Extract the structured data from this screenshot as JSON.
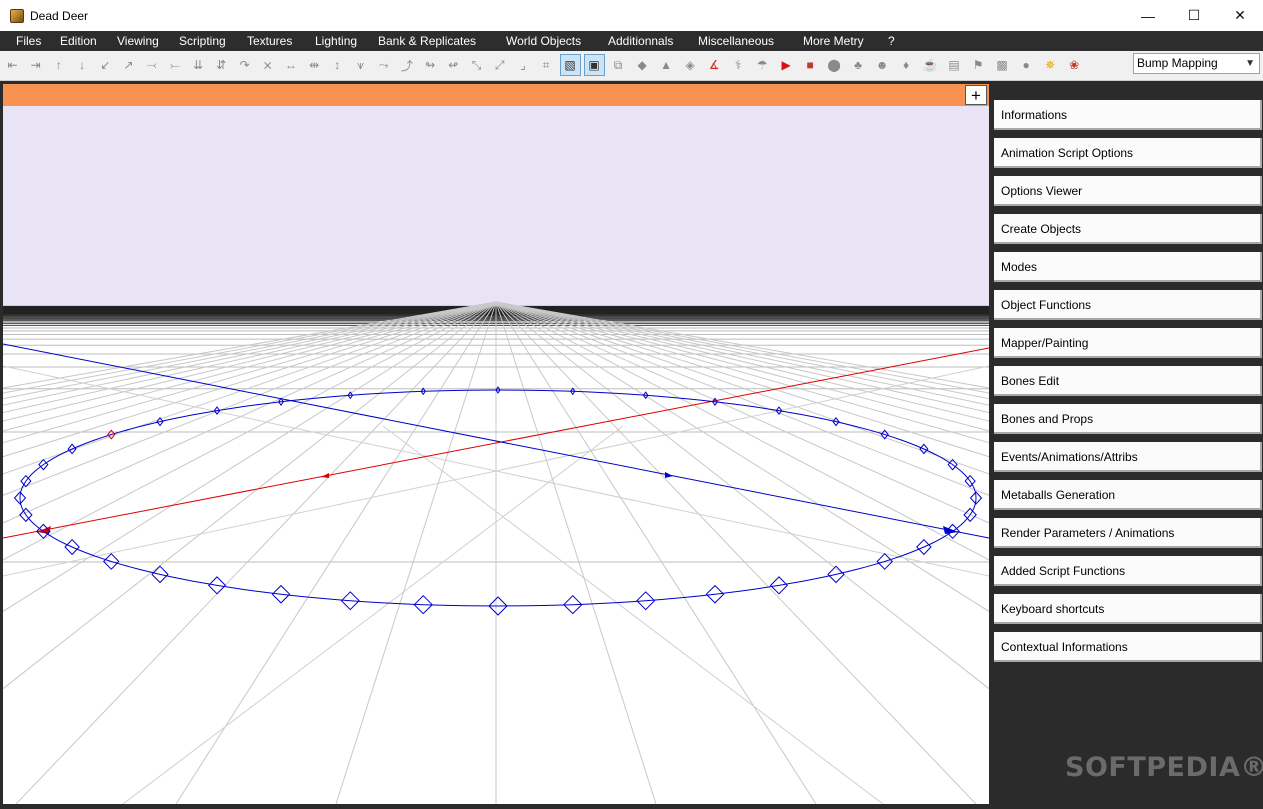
{
  "window": {
    "title": "Dead Deer",
    "minimize": "—",
    "maximize": "☐",
    "close": "✕"
  },
  "menu": [
    "Files",
    "Edition",
    "Viewing",
    "Scripting",
    "Textures",
    "Lighting",
    "Bank & Replicates",
    "World Objects",
    "Additionnals",
    "Miscellaneous",
    "More Metry",
    "?"
  ],
  "toolbar": {
    "tools": [
      {
        "name": "weld-left-tool",
        "glyph": "⇤"
      },
      {
        "name": "weld-right-tool",
        "glyph": "⇥"
      },
      {
        "name": "move-up-tool",
        "glyph": "↑"
      },
      {
        "name": "move-down-tool",
        "glyph": "↓"
      },
      {
        "name": "split-diag-tool",
        "glyph": "↙"
      },
      {
        "name": "merge-diag-tool",
        "glyph": "↗"
      },
      {
        "name": "fork-left-tool",
        "glyph": "⤙"
      },
      {
        "name": "fork-right-tool",
        "glyph": "⤚"
      },
      {
        "name": "branch-down-tool",
        "glyph": "⇊"
      },
      {
        "name": "branch-split-tool",
        "glyph": "⇵"
      },
      {
        "name": "twist-tool",
        "glyph": "↷"
      },
      {
        "name": "cross-tool",
        "glyph": "⨯"
      },
      {
        "name": "stretch-h-tool",
        "glyph": "↔"
      },
      {
        "name": "compress-tool",
        "glyph": "⇹"
      },
      {
        "name": "stretch-v-tool",
        "glyph": "↕"
      },
      {
        "name": "fan-tool",
        "glyph": "⩛"
      },
      {
        "name": "bend-right-tool",
        "glyph": "⤳"
      },
      {
        "name": "bend-left-tool",
        "glyph": "⤴"
      },
      {
        "name": "curve-tool",
        "glyph": "↬"
      },
      {
        "name": "curve-down-tool",
        "glyph": "↫"
      },
      {
        "name": "slope-tool",
        "glyph": "⤡"
      },
      {
        "name": "ramp-tool",
        "glyph": "⤢"
      },
      {
        "name": "corner-tool",
        "glyph": "⌟"
      },
      {
        "name": "grid-tool",
        "glyph": "⌗"
      },
      {
        "name": "cube-wire-tool",
        "glyph": "▧",
        "active": true
      },
      {
        "name": "cube-solid-tool",
        "glyph": "▣",
        "active": true
      },
      {
        "name": "cubes-tool",
        "glyph": "⧉"
      },
      {
        "name": "prism-tool",
        "glyph": "◆"
      },
      {
        "name": "pyramid-tool",
        "glyph": "▲"
      },
      {
        "name": "wedge-tool",
        "glyph": "◈"
      },
      {
        "name": "bone-red-tool",
        "glyph": "∡",
        "color": "#d22222"
      },
      {
        "name": "skeleton-tool",
        "glyph": "⚕"
      },
      {
        "name": "mushroom-tool",
        "glyph": "☂"
      },
      {
        "name": "play-tool",
        "glyph": "▶",
        "color": "#e01010"
      },
      {
        "name": "box-red-tool",
        "glyph": "■",
        "color": "#c0392b"
      },
      {
        "name": "blob-tool",
        "glyph": "⬤"
      },
      {
        "name": "tree-tool",
        "glyph": "♣"
      },
      {
        "name": "head-tool",
        "glyph": "☻"
      },
      {
        "name": "duck-tool",
        "glyph": "♦"
      },
      {
        "name": "pot-tool",
        "glyph": "☕"
      },
      {
        "name": "frame-tool",
        "glyph": "▤"
      },
      {
        "name": "bottle-tool",
        "glyph": "⚑"
      },
      {
        "name": "picture-tool",
        "glyph": "▩"
      },
      {
        "name": "sphere-tool",
        "glyph": "●"
      },
      {
        "name": "render-tool",
        "glyph": "✵",
        "color": "#e6a300"
      },
      {
        "name": "settings-tool",
        "glyph": "❀",
        "color": "#c0392b"
      }
    ],
    "render_mode": "Bump Mapping"
  },
  "panels": [
    "Informations",
    "Animation Script Options",
    "Options Viewer",
    "Create Objects",
    "Modes",
    "Object Functions",
    "Mapper/Painting",
    "Bones Edit",
    "Bones and Props",
    "Events/Animations/Attribs",
    "Metaballs Generation",
    "Render Parameters / Animations",
    "Added Script Functions",
    "Keyboard shortcuts",
    "Contextual Informations"
  ],
  "viewport": {
    "add_button": "+",
    "sky_color": "#e8e4f6",
    "header_color": "#f79250",
    "path_color": "#0000cc",
    "axis_x_color": "#dd0000",
    "axis_z_color": "#0000cc"
  },
  "watermark": "SOFTPEDIA®"
}
